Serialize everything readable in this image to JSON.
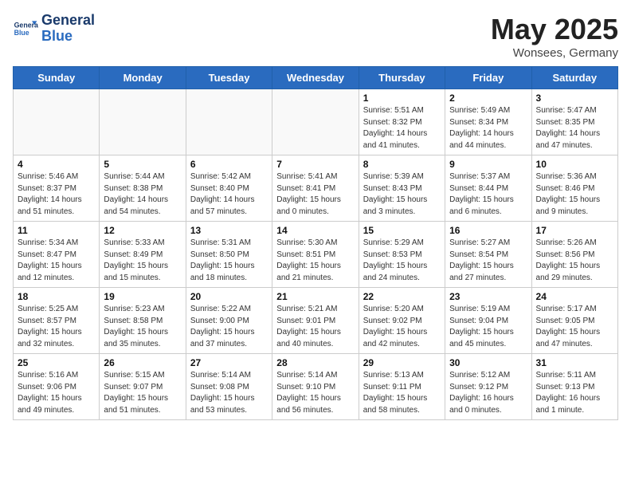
{
  "logo": {
    "line1": "General",
    "line2": "Blue"
  },
  "title": "May 2025",
  "subtitle": "Wonsees, Germany",
  "weekdays": [
    "Sunday",
    "Monday",
    "Tuesday",
    "Wednesday",
    "Thursday",
    "Friday",
    "Saturday"
  ],
  "weeks": [
    [
      {
        "day": "",
        "detail": ""
      },
      {
        "day": "",
        "detail": ""
      },
      {
        "day": "",
        "detail": ""
      },
      {
        "day": "",
        "detail": ""
      },
      {
        "day": "1",
        "detail": "Sunrise: 5:51 AM\nSunset: 8:32 PM\nDaylight: 14 hours\nand 41 minutes."
      },
      {
        "day": "2",
        "detail": "Sunrise: 5:49 AM\nSunset: 8:34 PM\nDaylight: 14 hours\nand 44 minutes."
      },
      {
        "day": "3",
        "detail": "Sunrise: 5:47 AM\nSunset: 8:35 PM\nDaylight: 14 hours\nand 47 minutes."
      }
    ],
    [
      {
        "day": "4",
        "detail": "Sunrise: 5:46 AM\nSunset: 8:37 PM\nDaylight: 14 hours\nand 51 minutes."
      },
      {
        "day": "5",
        "detail": "Sunrise: 5:44 AM\nSunset: 8:38 PM\nDaylight: 14 hours\nand 54 minutes."
      },
      {
        "day": "6",
        "detail": "Sunrise: 5:42 AM\nSunset: 8:40 PM\nDaylight: 14 hours\nand 57 minutes."
      },
      {
        "day": "7",
        "detail": "Sunrise: 5:41 AM\nSunset: 8:41 PM\nDaylight: 15 hours\nand 0 minutes."
      },
      {
        "day": "8",
        "detail": "Sunrise: 5:39 AM\nSunset: 8:43 PM\nDaylight: 15 hours\nand 3 minutes."
      },
      {
        "day": "9",
        "detail": "Sunrise: 5:37 AM\nSunset: 8:44 PM\nDaylight: 15 hours\nand 6 minutes."
      },
      {
        "day": "10",
        "detail": "Sunrise: 5:36 AM\nSunset: 8:46 PM\nDaylight: 15 hours\nand 9 minutes."
      }
    ],
    [
      {
        "day": "11",
        "detail": "Sunrise: 5:34 AM\nSunset: 8:47 PM\nDaylight: 15 hours\nand 12 minutes."
      },
      {
        "day": "12",
        "detail": "Sunrise: 5:33 AM\nSunset: 8:49 PM\nDaylight: 15 hours\nand 15 minutes."
      },
      {
        "day": "13",
        "detail": "Sunrise: 5:31 AM\nSunset: 8:50 PM\nDaylight: 15 hours\nand 18 minutes."
      },
      {
        "day": "14",
        "detail": "Sunrise: 5:30 AM\nSunset: 8:51 PM\nDaylight: 15 hours\nand 21 minutes."
      },
      {
        "day": "15",
        "detail": "Sunrise: 5:29 AM\nSunset: 8:53 PM\nDaylight: 15 hours\nand 24 minutes."
      },
      {
        "day": "16",
        "detail": "Sunrise: 5:27 AM\nSunset: 8:54 PM\nDaylight: 15 hours\nand 27 minutes."
      },
      {
        "day": "17",
        "detail": "Sunrise: 5:26 AM\nSunset: 8:56 PM\nDaylight: 15 hours\nand 29 minutes."
      }
    ],
    [
      {
        "day": "18",
        "detail": "Sunrise: 5:25 AM\nSunset: 8:57 PM\nDaylight: 15 hours\nand 32 minutes."
      },
      {
        "day": "19",
        "detail": "Sunrise: 5:23 AM\nSunset: 8:58 PM\nDaylight: 15 hours\nand 35 minutes."
      },
      {
        "day": "20",
        "detail": "Sunrise: 5:22 AM\nSunset: 9:00 PM\nDaylight: 15 hours\nand 37 minutes."
      },
      {
        "day": "21",
        "detail": "Sunrise: 5:21 AM\nSunset: 9:01 PM\nDaylight: 15 hours\nand 40 minutes."
      },
      {
        "day": "22",
        "detail": "Sunrise: 5:20 AM\nSunset: 9:02 PM\nDaylight: 15 hours\nand 42 minutes."
      },
      {
        "day": "23",
        "detail": "Sunrise: 5:19 AM\nSunset: 9:04 PM\nDaylight: 15 hours\nand 45 minutes."
      },
      {
        "day": "24",
        "detail": "Sunrise: 5:17 AM\nSunset: 9:05 PM\nDaylight: 15 hours\nand 47 minutes."
      }
    ],
    [
      {
        "day": "25",
        "detail": "Sunrise: 5:16 AM\nSunset: 9:06 PM\nDaylight: 15 hours\nand 49 minutes."
      },
      {
        "day": "26",
        "detail": "Sunrise: 5:15 AM\nSunset: 9:07 PM\nDaylight: 15 hours\nand 51 minutes."
      },
      {
        "day": "27",
        "detail": "Sunrise: 5:14 AM\nSunset: 9:08 PM\nDaylight: 15 hours\nand 53 minutes."
      },
      {
        "day": "28",
        "detail": "Sunrise: 5:14 AM\nSunset: 9:10 PM\nDaylight: 15 hours\nand 56 minutes."
      },
      {
        "day": "29",
        "detail": "Sunrise: 5:13 AM\nSunset: 9:11 PM\nDaylight: 15 hours\nand 58 minutes."
      },
      {
        "day": "30",
        "detail": "Sunrise: 5:12 AM\nSunset: 9:12 PM\nDaylight: 16 hours\nand 0 minutes."
      },
      {
        "day": "31",
        "detail": "Sunrise: 5:11 AM\nSunset: 9:13 PM\nDaylight: 16 hours\nand 1 minute."
      }
    ]
  ]
}
